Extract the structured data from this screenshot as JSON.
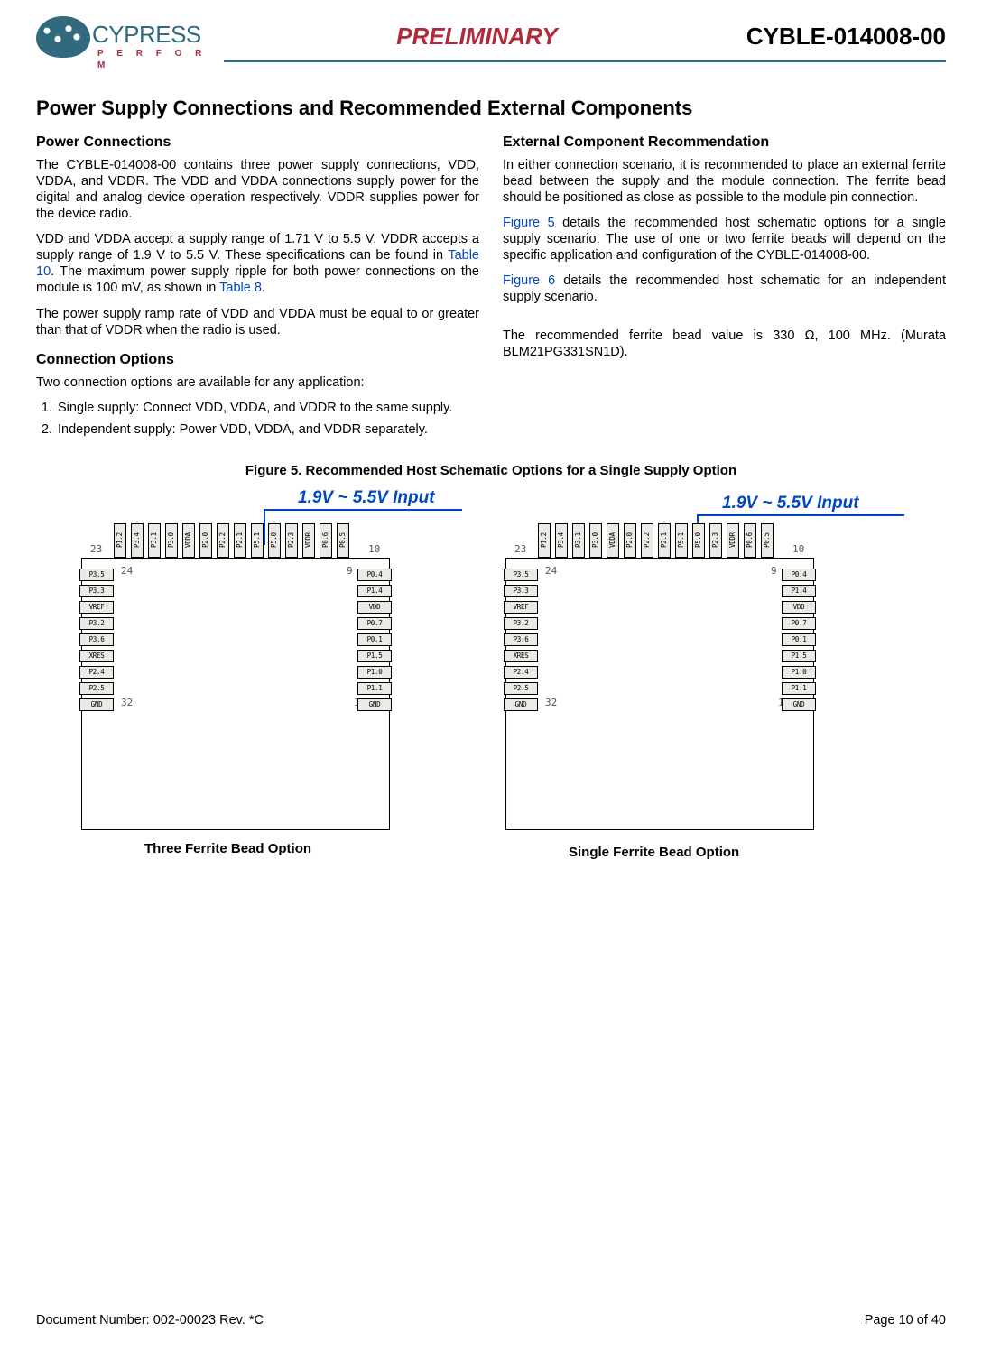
{
  "header": {
    "logo_text": "CYPRESS",
    "logo_sub": "P E R F O R M",
    "center": "PRELIMINARY",
    "right": "CYBLE-014008-00"
  },
  "title": "Power Supply Connections and Recommended External Components",
  "left": {
    "h_pc": "Power Connections",
    "p1": "The CYBLE-014008-00 contains three power supply connections, VDD, VDDA, and VDDR. The VDD and VDDA connections supply power for the digital and analog device operation respectively. VDDR supplies power for the device radio.",
    "p2a": "VDD and VDDA accept a supply range of 1.71 V to 5.5 V. VDDR accepts a supply range of 1.9 V to 5.5 V. These specifications can be found in ",
    "p2_link1": "Table 10",
    "p2b": ". The maximum power supply ripple for both power connections on the module is 100 mV, as shown in ",
    "p2_link2": "Table 8",
    "p2c": ".",
    "p3": "The power supply ramp rate of VDD and VDDA must be equal to or greater than that of VDDR when the radio is used.",
    "h_co": "Connection Options",
    "p4": "Two connection options are available for any application:",
    "li1": "Single supply: Connect VDD, VDDA, and VDDR to the same supply.",
    "li2": "Independent supply: Power VDD, VDDA, and VDDR separately."
  },
  "right": {
    "h_ecr": "External Component Recommendation",
    "p1": "In either connection scenario, it is recommended to place an external ferrite bead between the supply and the module connection. The ferrite bead should be positioned as close as possible to the module pin connection.",
    "p2a": "",
    "p2_link1": "Figure 5",
    "p2b": " details the recommended host schematic options for a single supply scenario. The use of one or two ferrite beads will depend on the specific application and configuration of the CYBLE-014008-00.",
    "p3_link1": "Figure 6",
    "p3b": " details the recommended host schematic for an independent supply scenario.",
    "p4": "The recommended ferrite bead value is 330 Ω, 100 MHz. (Murata BLM21PG331SN1D)."
  },
  "figure": {
    "caption": "Figure 5.  Recommended Host Schematic Options for a Single Supply Option",
    "vlabel": "1.9V ~ 5.5V Input",
    "opt_a": "Three Ferrite Bead Option",
    "opt_b": "Single Ferrite Bead Option",
    "corner_tl": "23",
    "corner_tlr": "10",
    "corner_bl": "32",
    "corner_blr": "1",
    "corner_in_l": "24",
    "corner_in_r": "9",
    "left_pins": [
      "P3.5",
      "P3.3",
      "VREF",
      "P3.2",
      "P3.6",
      "XRES",
      "P2.4",
      "P2.5",
      "GND"
    ],
    "right_pins": [
      "P0.4",
      "P1.4",
      "VDD",
      "P0.7",
      "P0.1",
      "P1.5",
      "P1.0",
      "P1.1",
      "GND"
    ],
    "top_pins": [
      "P1.2",
      "P3.4",
      "P3.1",
      "P3.0",
      "VDDA",
      "P2.0",
      "P2.2",
      "P2.1",
      "P5.1",
      "P5.0",
      "P2.3",
      "VDDR",
      "P0.6",
      "P0.5"
    ]
  },
  "footer": {
    "left": "Document Number: 002-00023 Rev. *C",
    "right": "Page 10 of 40"
  }
}
